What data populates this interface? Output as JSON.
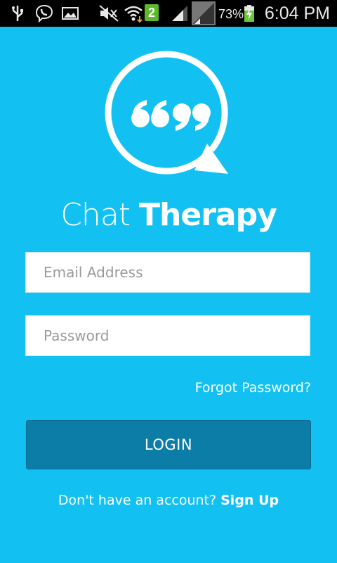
{
  "status_bar": {
    "battery_percent": "73%",
    "time": "6:04 PM",
    "icons": [
      "usb-icon",
      "viber-icon",
      "gallery-icon",
      "mute-icon",
      "wifi-icon",
      "sim2-icon",
      "signal-icon",
      "signal-icon",
      "battery-charging-icon"
    ],
    "sim_badge": "2"
  },
  "logo": {
    "icon": "speech-bubble-quotes-icon",
    "brand_light": "Chat",
    "brand_bold": "Therapy"
  },
  "form": {
    "email_placeholder": "Email Address",
    "password_placeholder": "Password",
    "forgot_label": "Forgot Password?",
    "login_label": "LOGIN",
    "signup_prompt": "Don't have an account?",
    "signup_label": "Sign Up"
  },
  "colors": {
    "background": "#12c1f2",
    "button": "#0b7da6"
  }
}
